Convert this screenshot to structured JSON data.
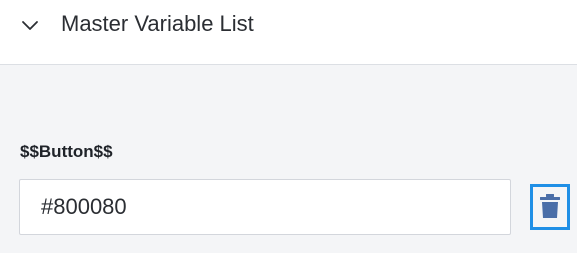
{
  "section": {
    "title": "Master Variable List",
    "expanded": true
  },
  "variable": {
    "label": "$$Button$$",
    "value": "#800080"
  },
  "colors": {
    "accent": "#1f8fe6",
    "trash_icon": "#4a6ea8"
  },
  "icons": {
    "toggle": "chevron-down-icon",
    "delete": "trash-icon"
  }
}
